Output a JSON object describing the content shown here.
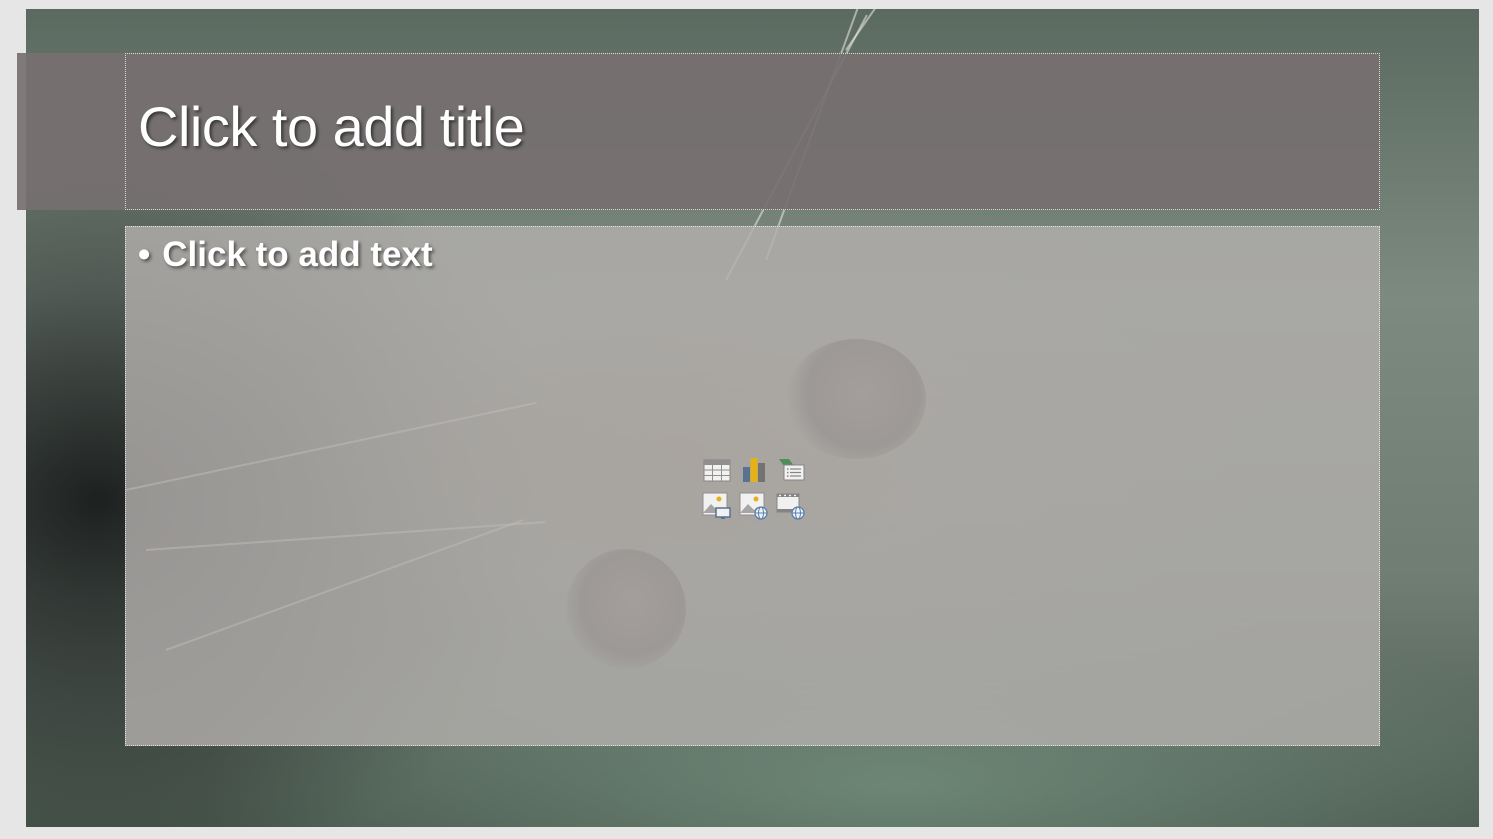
{
  "slide": {
    "title_placeholder": "Click to add title",
    "body_bullet_char": "•",
    "body_placeholder": "Click to add text"
  },
  "content_icons": [
    {
      "name": "insert-table-icon"
    },
    {
      "name": "insert-chart-icon"
    },
    {
      "name": "insert-smartart-icon"
    },
    {
      "name": "insert-picture-icon"
    },
    {
      "name": "insert-online-picture-icon"
    },
    {
      "name": "insert-video-icon"
    }
  ],
  "colors": {
    "title_band": "#767070",
    "body_placeholder_fill": "#b2aeac",
    "placeholder_text": "#ffffff",
    "chart_icon_yellow": "#f0b400"
  }
}
